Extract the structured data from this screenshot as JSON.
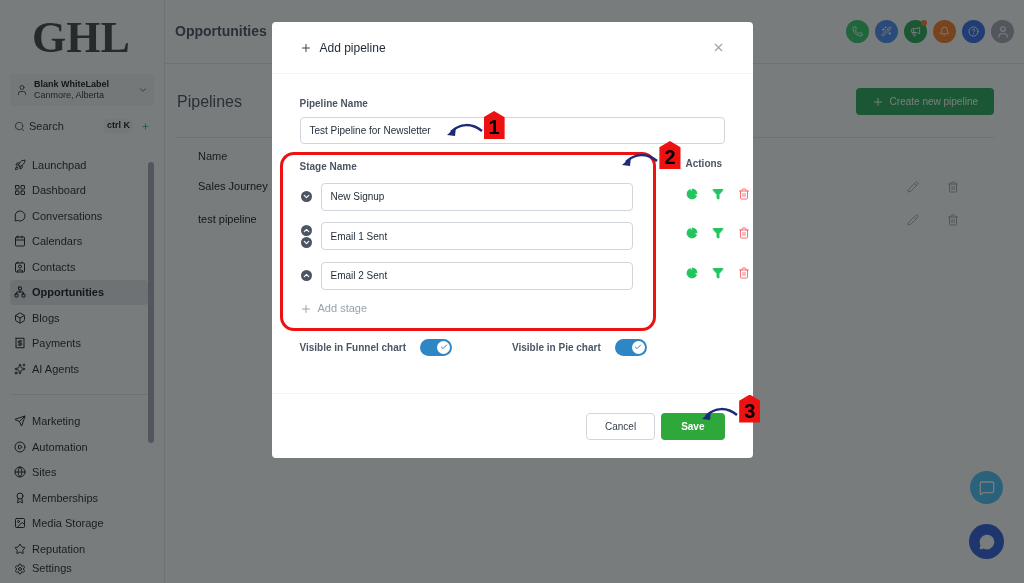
{
  "app": {
    "logo": "GHL",
    "header_title": "Opportunities",
    "account": {
      "name": "Blank WhiteLabel",
      "location": "Canmore, Alberta"
    },
    "search": {
      "placeholder": "Search",
      "shortcut": "ctrl K"
    }
  },
  "sidebar": {
    "sections": [
      {
        "items": [
          {
            "label": "Launchpad",
            "selected": false
          },
          {
            "label": "Dashboard",
            "selected": false
          },
          {
            "label": "Conversations",
            "selected": false
          },
          {
            "label": "Calendars",
            "selected": false
          },
          {
            "label": "Contacts",
            "selected": false
          },
          {
            "label": "Opportunities",
            "selected": true
          },
          {
            "label": "Blogs",
            "selected": false
          },
          {
            "label": "Payments",
            "selected": false
          },
          {
            "label": "AI Agents",
            "selected": false
          }
        ]
      },
      {
        "items": [
          {
            "label": "Marketing",
            "selected": false
          },
          {
            "label": "Automation",
            "selected": false
          },
          {
            "label": "Sites",
            "selected": false
          },
          {
            "label": "Memberships",
            "selected": false
          },
          {
            "label": "Media Storage",
            "selected": false
          },
          {
            "label": "Reputation",
            "selected": false
          }
        ]
      }
    ],
    "footer_item": {
      "label": "Settings"
    }
  },
  "page": {
    "title": "Pipelines",
    "create_button": "Create new pipeline",
    "table": {
      "columns": [
        "Name"
      ],
      "rows": [
        {
          "name": "Sales Journey"
        },
        {
          "name": "test pipeline"
        }
      ]
    }
  },
  "modal": {
    "title": "Add pipeline",
    "name_label": "Pipeline Name",
    "name_value": "Test Pipeline for Newsletter",
    "stage_label": "Stage Name",
    "actions_label": "Actions",
    "stages": [
      {
        "name": "New Signup",
        "can_move_up": false,
        "can_move_down": true
      },
      {
        "name": "Email 1 Sent",
        "can_move_up": true,
        "can_move_down": true
      },
      {
        "name": "Email 2 Sent",
        "can_move_up": true,
        "can_move_down": false
      }
    ],
    "add_stage": "Add stage",
    "toggles": [
      {
        "label": "Visible in Funnel chart",
        "on": true
      },
      {
        "label": "Visible in Pie chart",
        "on": true
      }
    ],
    "cancel": "Cancel",
    "save": "Save"
  },
  "annotations": [
    "1",
    "2",
    "3"
  ]
}
